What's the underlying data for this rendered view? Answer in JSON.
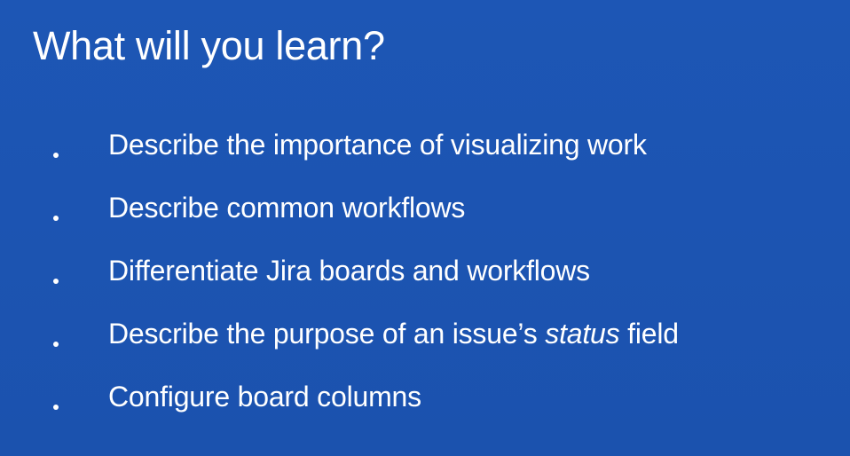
{
  "slide": {
    "title": "What will you learn?",
    "bullets": [
      {
        "text": "Describe the importance of visualizing work"
      },
      {
        "text": "Describe common workflows"
      },
      {
        "text": "Differentiate Jira boards and workflows"
      },
      {
        "text_before": "Describe the purpose of an issue’s ",
        "text_italic": "status",
        "text_after": " field"
      },
      {
        "text": "Configure board columns"
      }
    ],
    "colors": {
      "background": "#1c54b2",
      "text": "#ffffff"
    }
  }
}
